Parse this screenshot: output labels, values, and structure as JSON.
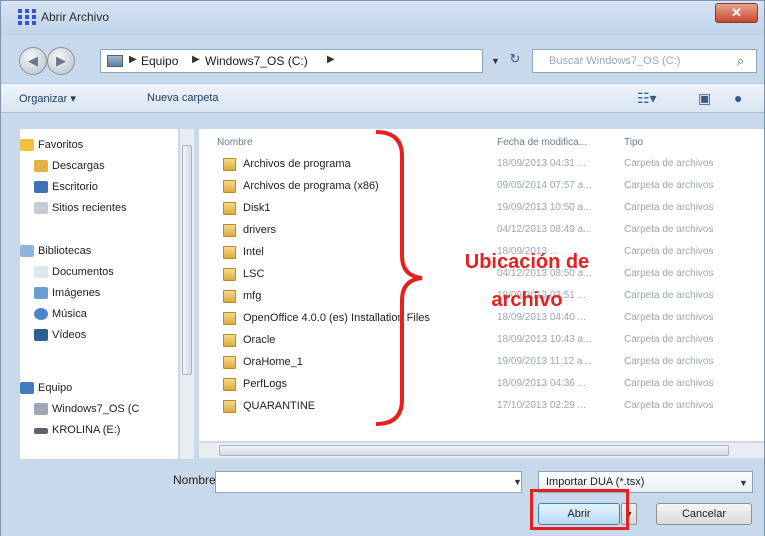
{
  "window": {
    "title": "Abrir Archivo",
    "close_label": "✕"
  },
  "address": {
    "crumbs": [
      "Equipo",
      "Windows7_OS (C:)"
    ],
    "search_placeholder": "Buscar Windows7_OS (C:)"
  },
  "toolbar": {
    "organize_label": "Organizar ▾",
    "new_folder_label": "Nueva carpeta"
  },
  "nav": {
    "favorites": "Favoritos",
    "downloads": "Descargas",
    "desktop": "Escritorio",
    "recent": "Sitios recientes",
    "libraries": "Bibliotecas",
    "documents": "Documentos",
    "images": "Imágenes",
    "music": "Música",
    "videos": "Vídeos",
    "computer": "Equipo",
    "drive_c": "Windows7_OS (C",
    "drive_e": "KROLINA (E:)"
  },
  "columns": {
    "name": "Nombre",
    "date": "Fecha de modifica...",
    "type": "Tipo"
  },
  "files": [
    {
      "name": "Archivos de programa",
      "date": "18/09/2013 04:31 ...",
      "type": "Carpeta de archivos"
    },
    {
      "name": "Archivos de programa (x86)",
      "date": "09/05/2014 07:57 a...",
      "type": "Carpeta de archivos"
    },
    {
      "name": "Disk1",
      "date": "19/09/2013 10:50 a...",
      "type": "Carpeta de archivos"
    },
    {
      "name": "drivers",
      "date": "04/12/2013 08:49 a...",
      "type": "Carpeta de archivos"
    },
    {
      "name": "Intel",
      "date": "18/09/2013 ...",
      "type": "Carpeta de archivos"
    },
    {
      "name": "LSC",
      "date": "04/12/2013 08:50 a...",
      "type": "Carpeta de archivos"
    },
    {
      "name": "mfg",
      "date": "18/09/2013 03:51 ...",
      "type": "Carpeta de archivos"
    },
    {
      "name": "OpenOffice 4.0.0 (es) Installation Files",
      "date": "18/09/2013 04:40 ...",
      "type": "Carpeta de archivos"
    },
    {
      "name": "Oracle",
      "date": "18/09/2013 10:43 a...",
      "type": "Carpeta de archivos"
    },
    {
      "name": "OraHome_1",
      "date": "19/09/2013 11:12 a...",
      "type": "Carpeta de archivos"
    },
    {
      "name": "PerfLogs",
      "date": "18/09/2013 04:36 ...",
      "type": "Carpeta de archivos"
    },
    {
      "name": "QUARANTINE",
      "date": "17/10/2013 02:29 ...",
      "type": "Carpeta de archivos"
    }
  ],
  "bottom": {
    "name_label": "Nombre:",
    "name_value": "",
    "filter_value": "Importar DUA (*.tsx)",
    "open_label": "Abrir",
    "cancel_label": "Cancelar"
  },
  "annotation": {
    "line1": "Ubicación de",
    "line2": "archivo",
    "color": "#e6201e"
  }
}
